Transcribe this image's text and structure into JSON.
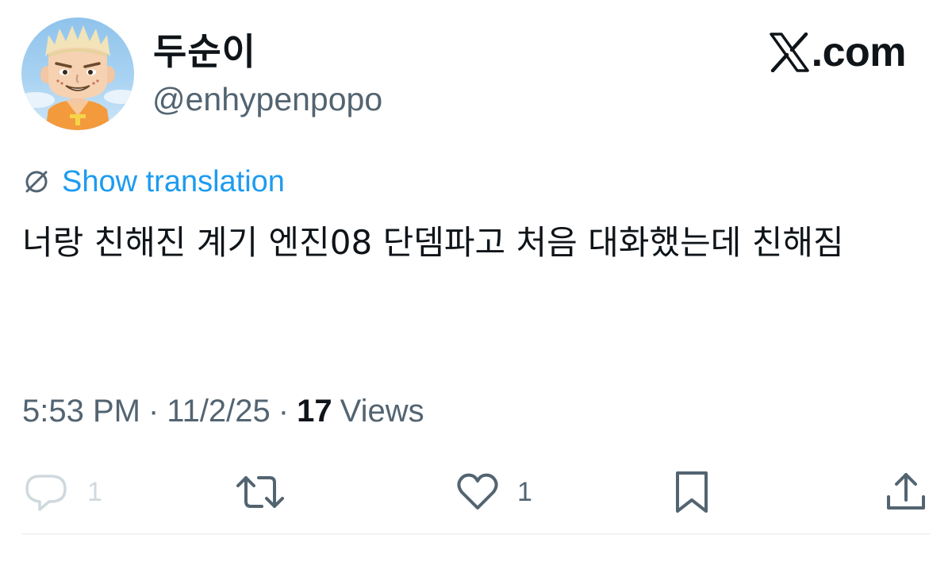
{
  "author": {
    "display_name": "두순이",
    "handle": "@enhypenpopo"
  },
  "brand": {
    "text": ".com",
    "icon": "x-logo"
  },
  "translation": {
    "icon": "globe-slash-icon",
    "label": "Show translation"
  },
  "tweet": {
    "text": "너랑 친해진 계기 엔진08 단뎀파고 처음 대화했는데 친해짐"
  },
  "meta": {
    "time": "5:53 PM",
    "separator": "·",
    "date": "11/2/25",
    "views_count": "17",
    "views_label": "Views"
  },
  "actions": {
    "reply": {
      "icon": "reply-icon",
      "count": "1"
    },
    "retweet": {
      "icon": "retweet-icon"
    },
    "like": {
      "icon": "heart-icon",
      "count": "1"
    },
    "bookmark": {
      "icon": "bookmark-icon"
    },
    "share": {
      "icon": "share-icon"
    }
  },
  "colors": {
    "link": "#1d9bf0",
    "text": "#0f1419",
    "secondary": "#536471",
    "faded": "#cfd9de"
  }
}
